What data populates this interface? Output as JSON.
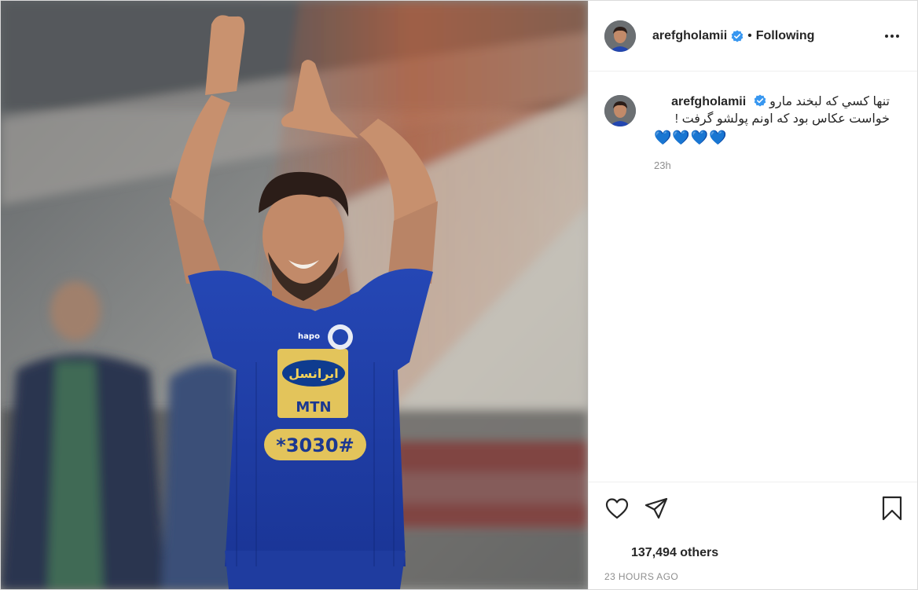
{
  "post": {
    "image_alt": "",
    "author": {
      "username": "arefgholamii",
      "verified": true,
      "follow_status": "Following",
      "separator": "•"
    },
    "caption": {
      "username": "arefgholamii",
      "line1": "تنها کسي که لبخند مارو",
      "line2": "خواست عکاس بود که اونم پولشو گرفت !",
      "hearts": "💙💙💙💙",
      "time": "23h"
    },
    "likes_text": "137,494 others",
    "posted_ago": "23 HOURS AGO",
    "icons": {
      "more": "more-options-icon",
      "like": "heart-icon",
      "share": "share-icon",
      "save": "bookmark-icon",
      "verified": "verified-badge-icon"
    },
    "colors": {
      "verified": "#3897f0",
      "jersey": "#1e3fa8",
      "hearts": "#1fb6e8",
      "muted": "#8e8e8e"
    }
  }
}
